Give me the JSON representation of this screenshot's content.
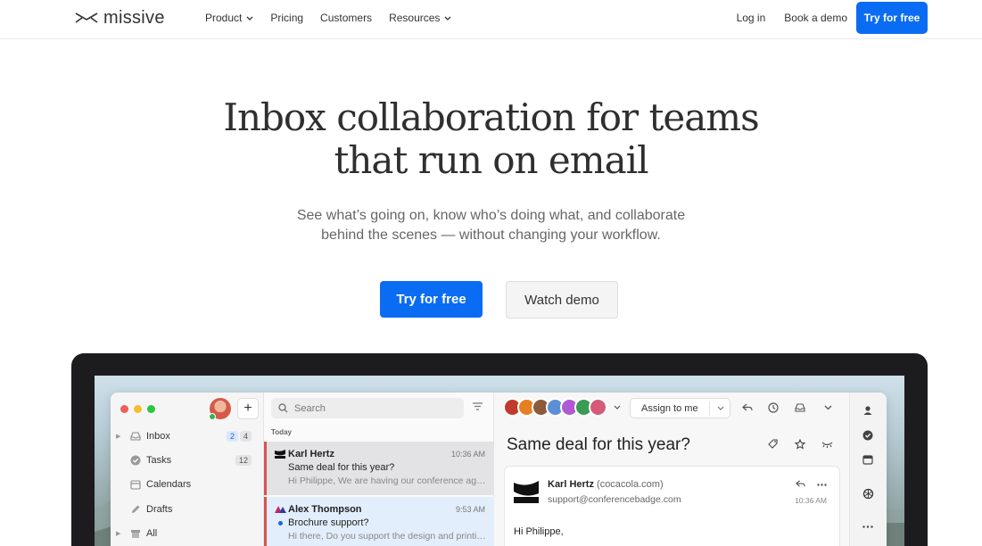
{
  "nav": {
    "logo_text": "missive",
    "links": [
      "Product",
      "Pricing",
      "Customers",
      "Resources"
    ],
    "login": "Log in",
    "book_demo": "Book a demo",
    "cta": "Try for free"
  },
  "hero": {
    "title_line1": "Inbox collaboration for teams",
    "title_line2": "that run on email",
    "subtitle_line1": "See what’s going on, know who’s doing what, and collaborate",
    "subtitle_line2": "behind the scenes — without changing your workflow.",
    "primary_cta": "Try for free",
    "secondary_cta": "Watch demo"
  },
  "app": {
    "sidebar": {
      "add_label": "+",
      "items": [
        {
          "label": "Inbox",
          "badges": [
            "2",
            "4"
          ]
        },
        {
          "label": "Tasks",
          "badges": [
            "12"
          ]
        },
        {
          "label": "Calendars",
          "badges": []
        },
        {
          "label": "Drafts",
          "badges": []
        },
        {
          "label": "All",
          "badges": []
        }
      ]
    },
    "list": {
      "search_placeholder": "Search",
      "section": "Today",
      "conversations": [
        {
          "from": "Karl Hertz",
          "time": "10:36 AM",
          "subject": "Same deal for this year?",
          "preview": "Hi Philippe, We are having our conference again this year"
        },
        {
          "from": "Alex Thompson",
          "time": "9:53 AM",
          "subject": "Brochure support?",
          "preview": "Hi there, Do you support the design and printing of brochures"
        }
      ]
    },
    "reader": {
      "assign": "Assign to me",
      "subject": "Same deal for this year?",
      "sender_name": "Karl Hertz",
      "sender_domain": "(cocacola.com)",
      "sender_address": "support@conferencebadge.com",
      "time": "10:36 AM",
      "greeting": "Hi Philippe,"
    },
    "colors": {
      "accent": "#0a6cf2",
      "avatars": [
        "#c0392b",
        "#e67e22",
        "#8e5a3c",
        "#5b8fd6",
        "#b05ad6",
        "#3a9b54",
        "#d65a7a"
      ]
    }
  }
}
